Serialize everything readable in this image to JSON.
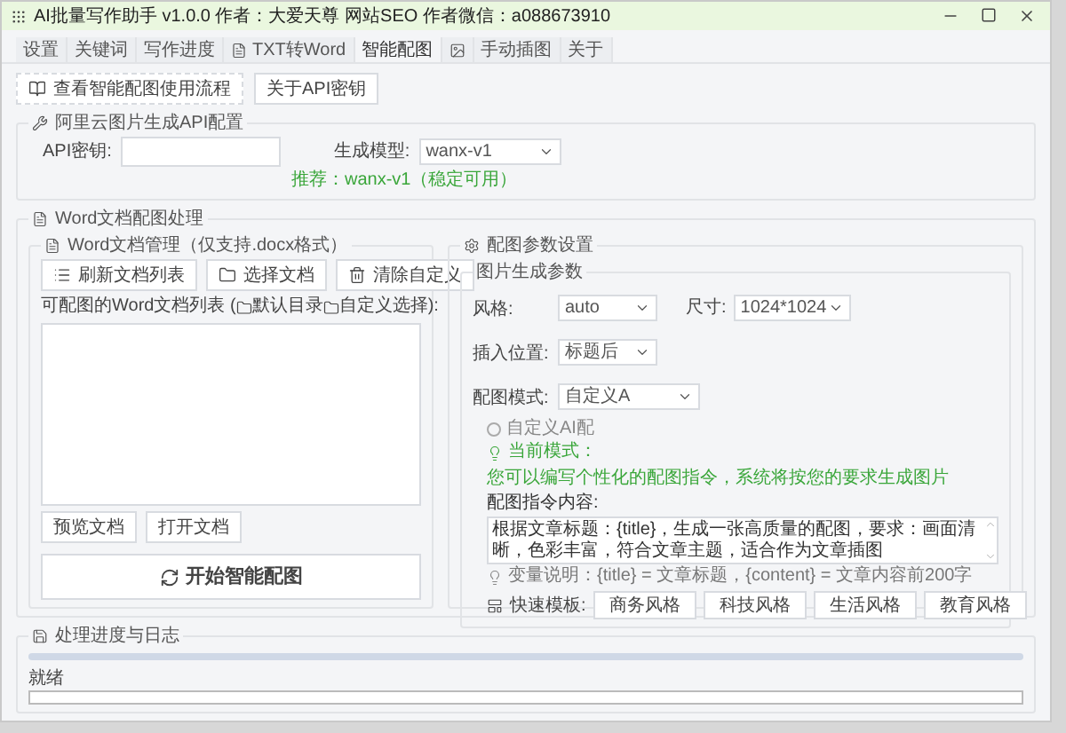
{
  "window": {
    "title": "AI批量写作助手 v1.0.0 作者：大爱天尊 网站SEO 作者微信：a088673910"
  },
  "tabs": [
    {
      "label": "设置",
      "selected": false
    },
    {
      "label": "关键词",
      "selected": false
    },
    {
      "label": "写作进度",
      "selected": false
    },
    {
      "label": "TXT转Word",
      "selected": false
    },
    {
      "label": "智能配图",
      "selected": true
    },
    {
      "selected": false
    },
    {
      "label": "手动插图",
      "selected": false
    },
    {
      "label": "关于",
      "selected": false
    }
  ],
  "toolbar": {
    "guide_button": "查看智能配图使用流程",
    "api_button": "关于API密钥"
  },
  "api_group": {
    "title": "阿里云图片生成API配置",
    "key_label": "API密钥:",
    "model_label": "生成模型:",
    "model_value": "wanx-v1",
    "hint": "推荐：wanx-v1（稳定可用）"
  },
  "word_group": {
    "title": "Word文档配图处理",
    "docs": {
      "title": "Word文档管理（仅支持.docx格式）",
      "buttons": [
        "刷新文档列表",
        "选择文档",
        "清除自定义"
      ],
      "list_label_start": "可配图的Word文档列表 (",
      "default_dir": "默认目录",
      "custom_dir": "自定义选择):",
      "preview_button": "预览文档",
      "open_button": "打开文档",
      "start_button": "开始智能配图"
    },
    "params": {
      "title": "配图参数设置",
      "subtitle": "图片生成参数",
      "style_label": "风格:",
      "style_value": "auto",
      "size_label": "尺寸:",
      "size_value": "1024*1024",
      "position_label": "插入位置:",
      "position_value": "标题后",
      "mode_label": "配图模式:",
      "mode_value": "自定义A",
      "radio": {
        "label": "自定义AI配",
        "selected": false
      },
      "mode_hint": "当前模式：",
      "hint_line": "您可以编写个性化的配图指令，系统将按您的要求生成图片",
      "prompt_label": "配图指令内容:",
      "prompt": "根据文章标题：{title}，生成一张高质量的配图，要求：画面清晰，色彩丰富，符合文章主题，适合作为文章插图",
      "vars": "变量说明：{title} = 文章标题，{content} = 文章内容前200字",
      "quick_label": "快速模板:",
      "templates": [
        "商务风格",
        "科技风格",
        "生活风格",
        "教育风格"
      ]
    }
  },
  "log_group": {
    "title": "处理进度与日志",
    "progress": {
      "level": 0
    },
    "status": "就绪"
  }
}
